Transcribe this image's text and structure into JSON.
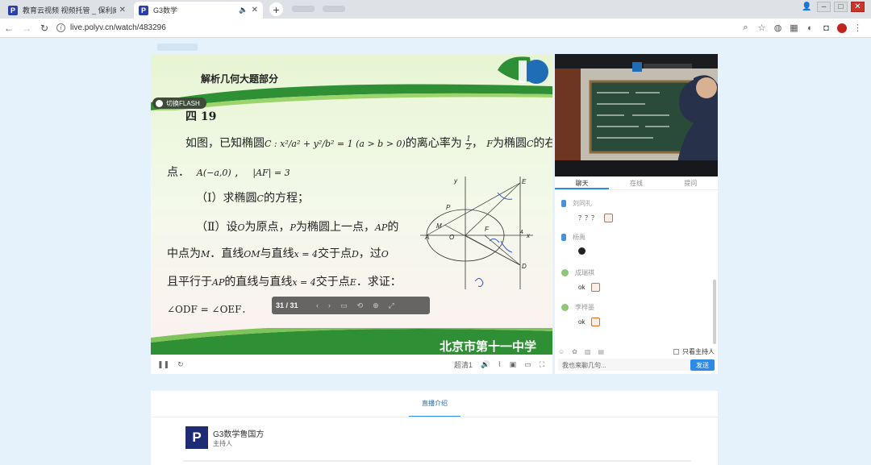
{
  "browser": {
    "tabs": [
      {
        "title": "教育云视频 视频托管 _ 保利威云",
        "active": false
      },
      {
        "title": "G3数学",
        "active": true
      }
    ],
    "url": "live.polyv.cn/watch/483296",
    "favicon_letter": "P",
    "toolbar_icons": [
      "zoom-icon",
      "star-icon",
      "translate-icon",
      "qr-icon",
      "extension-icon",
      "camera-icon",
      "profile-icon"
    ]
  },
  "slide": {
    "header": "解析几何大题部分",
    "flash_label": "切换FLASH",
    "problem_number": "四 19",
    "lines": {
      "l1_a": "如图，已知椭圆",
      "l1_b": "的离心率为",
      "l1_c": "，",
      "l1_d": "为椭圆",
      "l1_e": "的右焦",
      "l2": "点．",
      "l3": "（Ⅰ）求椭圆",
      "l3_b": "的方程；",
      "l4": "（Ⅱ）设",
      "l4_b": "为原点，",
      "l4_c": "为椭圆上一点，",
      "l4_d": "的",
      "l5": "中点为",
      "l5_b": "．直线",
      "l5_c": "与直线",
      "l5_d": "交于点",
      "l5_e": "，过",
      "l6": "且平行于",
      "l6_b": "的直线与直线",
      "l6_c": "交于点",
      "l6_d": "．求证：",
      "l7": "∠ODF = ∠OEF．"
    },
    "math": {
      "ellipse": "C : x²/a² + y²/b² = 1 (a > b > 0)",
      "eccentricity_num": "1",
      "eccentricity_den": "2",
      "F": "F",
      "C": "C",
      "A": "A(−a,0)",
      "AF": "|AF| = 3",
      "O": "O",
      "P": "P",
      "AP": "AP",
      "M": "M",
      "OM": "OM",
      "x4": "x = 4",
      "D": "D",
      "E": "E"
    },
    "diagram_labels": [
      "y",
      "E",
      "P",
      "M",
      "A",
      "O",
      "F",
      "4",
      "x",
      "D"
    ],
    "school": "北京市第十一中学",
    "page_indicator": "31 / 31"
  },
  "player": {
    "quality": "超清1"
  },
  "chat": {
    "tabs": [
      "聊天",
      "在线",
      "提问"
    ],
    "messages": [
      {
        "name": "刘同礼",
        "text": "？？？",
        "avatar": "phone"
      },
      {
        "name": "杨禹",
        "text": "",
        "avatar": "phone"
      },
      {
        "name": "成瑞祺",
        "text": "ok",
        "avatar": "user"
      },
      {
        "name": "李梓墨",
        "text": "ok",
        "avatar": "user"
      }
    ],
    "host_only_label": "只看主持人",
    "input_placeholder": "我也来聊几句...",
    "send_label": "发送"
  },
  "info": {
    "tab": "直播介绍",
    "host_name": "G3数学鲁国方",
    "host_role": "主持人"
  },
  "colors": {
    "accent": "#2d8ae6",
    "brand": "#1c2b74",
    "slide_band": "#3c9a3c"
  }
}
